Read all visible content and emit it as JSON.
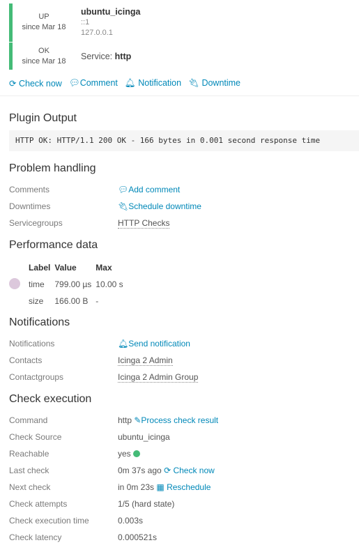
{
  "host": {
    "state": "UP",
    "since": "since Mar 18",
    "name": "ubuntu_icinga",
    "address6": "::1",
    "address": "127.0.0.1"
  },
  "service": {
    "state": "OK",
    "since": "since Mar 18",
    "prefix": "Service:",
    "name": "http"
  },
  "actions": {
    "check_now": "Check now",
    "comment": "Comment",
    "notification": "Notification",
    "downtime": "Downtime"
  },
  "plugin_output": {
    "title": "Plugin Output",
    "text": "HTTP OK: HTTP/1.1 200 OK - 166 bytes in 0.001 second response time"
  },
  "problem": {
    "title": "Problem handling",
    "comments_label": "Comments",
    "comments_value": "Add comment",
    "downtimes_label": "Downtimes",
    "downtimes_value": "Schedule downtime",
    "servicegroups_label": "Servicegroups",
    "servicegroups_value": "HTTP Checks"
  },
  "perf": {
    "title": "Performance data",
    "headers": [
      "Label",
      "Value",
      "Max"
    ],
    "rows": [
      [
        "time",
        "799.00 µs",
        "10.00 s"
      ],
      [
        "size",
        "166.00 B",
        "-"
      ]
    ]
  },
  "notifications": {
    "title": "Notifications",
    "notif_label": "Notifications",
    "notif_value": "Send notification",
    "contacts_label": "Contacts",
    "contacts_value": "Icinga 2 Admin",
    "groups_label": "Contactgroups",
    "groups_value": "Icinga 2 Admin Group"
  },
  "check": {
    "title": "Check execution",
    "command_label": "Command",
    "command_value": "http",
    "process": "Process check result",
    "source_label": "Check Source",
    "source_value": "ubuntu_icinga",
    "reach_label": "Reachable",
    "reach_value": "yes",
    "last_label": "Last check",
    "last_value": "0m 37s ago",
    "last_action": "Check now",
    "next_label": "Next check",
    "next_value": "in 0m 23s",
    "next_action": "Reschedule",
    "attempts_label": "Check attempts",
    "attempts_value": "1/5 (hard state)",
    "exec_label": "Check execution time",
    "exec_value": "0.003s",
    "latency_label": "Check latency",
    "latency_value": "0.000521s"
  }
}
